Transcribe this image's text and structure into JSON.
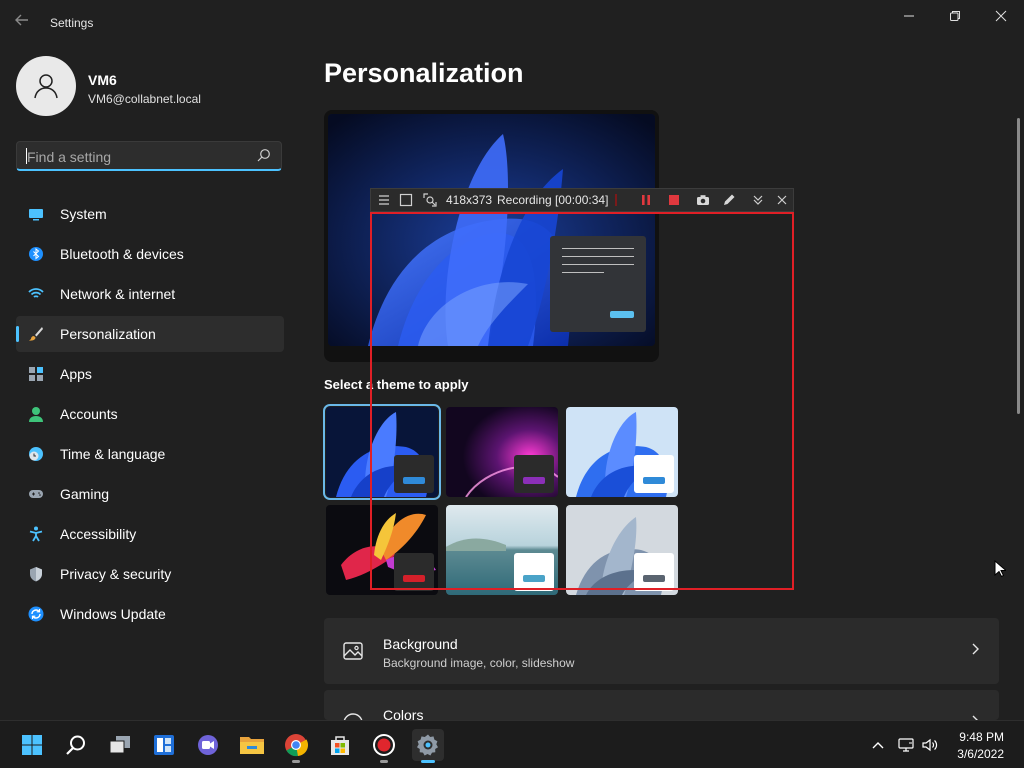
{
  "window": {
    "title": "Settings",
    "back_icon": "back-arrow-icon",
    "minimize_icon": "minimize-icon",
    "restore_icon": "restore-icon",
    "close_icon": "close-icon"
  },
  "user": {
    "name": "VM6",
    "email": "VM6@collabnet.local"
  },
  "search": {
    "placeholder": "Find a setting",
    "value": ""
  },
  "sidebar": {
    "items": [
      {
        "label": "System",
        "icon": "system-display-icon",
        "color": "#4cc2ff"
      },
      {
        "label": "Bluetooth & devices",
        "icon": "bluetooth-icon",
        "color": "#1e90ff"
      },
      {
        "label": "Network & internet",
        "icon": "wifi-icon",
        "color": "#4cc2ff"
      },
      {
        "label": "Personalization",
        "icon": "paintbrush-icon",
        "color": "#e8a33c",
        "active": true
      },
      {
        "label": "Apps",
        "icon": "apps-icon",
        "color": "#9aa5b1"
      },
      {
        "label": "Accounts",
        "icon": "accounts-icon",
        "color": "#3ec47a"
      },
      {
        "label": "Time & language",
        "icon": "globe-clock-icon",
        "color": "#4cc2ff"
      },
      {
        "label": "Gaming",
        "icon": "gamepad-icon",
        "color": "#9aa5b1"
      },
      {
        "label": "Accessibility",
        "icon": "accessibility-icon",
        "color": "#4cc2ff"
      },
      {
        "label": "Privacy & security",
        "icon": "shield-icon",
        "color": "#9aa5b1"
      },
      {
        "label": "Windows Update",
        "icon": "windows-update-icon",
        "color": "#1e90ff"
      }
    ]
  },
  "main": {
    "title": "Personalization",
    "theme_heading": "Select a theme to apply",
    "themes": [
      {
        "name": "windows-dark-bloom",
        "selected": true,
        "accent": "#2f8ad8",
        "window_bg": "#2b2b2b"
      },
      {
        "name": "glow-purple",
        "selected": false,
        "accent": "#8b2fb8",
        "window_bg": "#2b2b2b"
      },
      {
        "name": "windows-light-bloom",
        "selected": false,
        "accent": "#2f8ad8",
        "window_bg": "#ffffff"
      },
      {
        "name": "captured-motion",
        "selected": false,
        "accent": "#d4202a",
        "window_bg": "#2b2b2b"
      },
      {
        "name": "sunrise-lake",
        "selected": false,
        "accent": "#4aa3c8",
        "window_bg": "#ffffff"
      },
      {
        "name": "flow-gray",
        "selected": false,
        "accent": "#5a6470",
        "window_bg": "#ffffff"
      }
    ],
    "cards": [
      {
        "title": "Background",
        "subtitle": "Background image, color, slideshow",
        "icon": "image-icon"
      },
      {
        "title": "Colors",
        "subtitle": "",
        "icon": "palette-icon"
      }
    ]
  },
  "recorder": {
    "size": "418x373",
    "status": "Recording [00:00:34]",
    "tools": [
      "menu-icon",
      "region-icon",
      "zoom-region-icon",
      "pause-icon",
      "stop-icon",
      "camera-icon",
      "pen-icon",
      "collapse-icon",
      "close-icon"
    ],
    "frame_color": "#e01f26"
  },
  "taskbar": {
    "apps": [
      {
        "name": "start-icon",
        "active": false
      },
      {
        "name": "search-icon",
        "active": false
      },
      {
        "name": "task-view-icon",
        "active": false
      },
      {
        "name": "widgets-icon",
        "active": false
      },
      {
        "name": "teams-chat-icon",
        "active": false
      },
      {
        "name": "file-explorer-icon",
        "active": false
      },
      {
        "name": "chrome-icon",
        "active": false
      },
      {
        "name": "store-icon",
        "active": false
      },
      {
        "name": "screen-recorder-icon",
        "active": false
      },
      {
        "name": "settings-icon",
        "active": true
      }
    ],
    "tray": [
      "chevron-up-icon",
      "network-icon",
      "volume-icon"
    ],
    "time": "9:48 PM",
    "date": "3/6/2022"
  },
  "colors": {
    "accent": "#4cc2ff",
    "background": "#202020",
    "card": "#2b2b2b"
  }
}
